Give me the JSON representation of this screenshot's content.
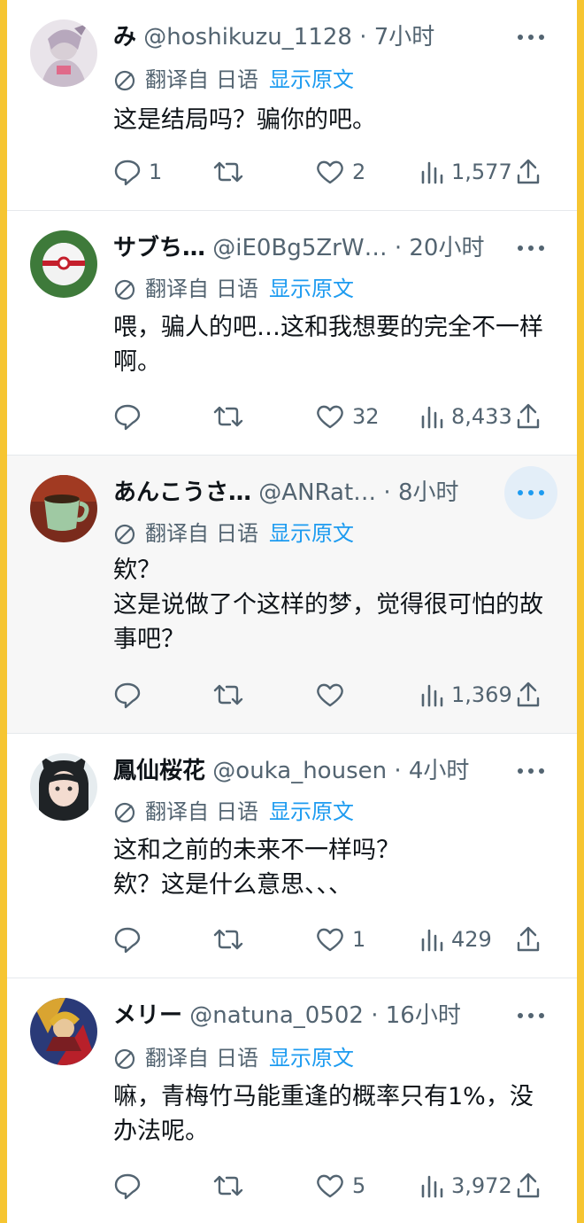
{
  "translation": {
    "translated_from": "翻译自",
    "language": "日语",
    "show_original": "显示原文"
  },
  "replies": [
    {
      "name": "み",
      "handle": "@hoshikuzu_1128",
      "time": "7小时",
      "text": "这是结局吗？骗你的吧。",
      "replies": "1",
      "retweets": "",
      "likes": "2",
      "views": "1,577",
      "avatar": "anime-girl-avatar"
    },
    {
      "name": "サブち…",
      "handle": "@iE0Bg5ZrW…",
      "time": "20小时",
      "text": "喂，骗人的吧…这和我想要的完全不一样啊。",
      "replies": "",
      "retweets": "",
      "likes": "32",
      "views": "8,433",
      "avatar": "pokeball-avatar"
    },
    {
      "name": "あんこうさ…",
      "handle": "@ANRat…",
      "time": "8小时",
      "text": "欸？\n这是说做了个这样的梦，觉得很可怕的故事吧？",
      "replies": "",
      "retweets": "",
      "likes": "",
      "views": "1,369",
      "avatar": "coffee-cup-avatar"
    },
    {
      "name": "鳳仙桜花",
      "handle": "@ouka_housen",
      "time": "4小时",
      "text": "这和之前的未来不一样吗？\n欸？这是什么意思、、、",
      "replies": "",
      "retweets": "",
      "likes": "1",
      "views": "429",
      "avatar": "cat-ear-girl-avatar"
    },
    {
      "name": "メリー",
      "handle": "@natuna_0502",
      "time": "16小时",
      "text": "嘛，青梅竹马能重逢的概率只有1%，没办法呢。",
      "replies": "",
      "retweets": "",
      "likes": "5",
      "views": "3,972",
      "avatar": "warrior-art-avatar"
    }
  ],
  "colors": {
    "frame_border": "#f6c531",
    "link_blue": "#1d9bf0",
    "secondary_text": "#536471"
  }
}
